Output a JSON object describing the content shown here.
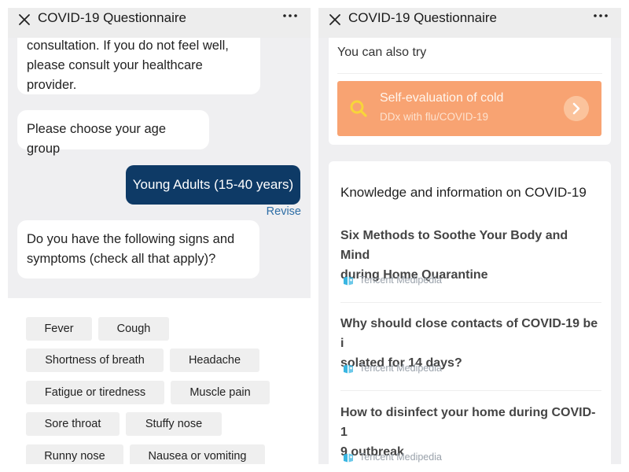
{
  "left": {
    "title": "COVID-19 Questionnaire",
    "messages": {
      "consult_lines": [
        "consultation. If you do not feel well,",
        "please consult your healthcare",
        "provider."
      ],
      "age_prompt": "Please choose your age group",
      "user_answer": "Young Adults (15-40 years)",
      "revise": "Revise",
      "symptoms_lines": [
        "Do you have the following signs and",
        "symptoms (check all that apply)?"
      ]
    },
    "symptoms": [
      "Fever",
      "Cough",
      "Shortness of breath",
      "Headache",
      "Fatigue or tiredness",
      "Muscle pain",
      "Sore throat",
      "Stuffy nose",
      "Runny nose",
      "Nausea or vomiting"
    ]
  },
  "right": {
    "title": "COVID-19 Questionnaire",
    "try_label": "You can also try",
    "self_eval": {
      "title": "Self-evaluation of cold",
      "subtitle": "DDx with flu/COVID-19"
    },
    "knowledge_heading": "Knowledge and information on COVID-19",
    "articles": [
      {
        "title_lines": [
          "Six Methods to Soothe Your Body and Mind",
          "during Home Quarantine"
        ],
        "source": "Tencent Medipedia"
      },
      {
        "title_lines": [
          "Why should close contacts of COVID-19 be i",
          "solated for 14 days?"
        ],
        "source": "Tencent Medipedia"
      },
      {
        "title_lines": [
          "How to disinfect your home during COVID-1",
          "9 outbreak"
        ],
        "source": "Tencent Medipedia"
      }
    ]
  },
  "icons": {
    "close": "close-icon",
    "more": "more-dots-icon",
    "search": "search-icon",
    "chevron": "chevron-right-icon",
    "source_logo": "medipedia-logo-icon"
  },
  "colors": {
    "user_bubble": "#0e3a66",
    "revise_link": "#2e6ea6",
    "self_eval_card": "#f8a372",
    "search_icon": "#f8d53a",
    "source_logo": "#39b6e2"
  }
}
